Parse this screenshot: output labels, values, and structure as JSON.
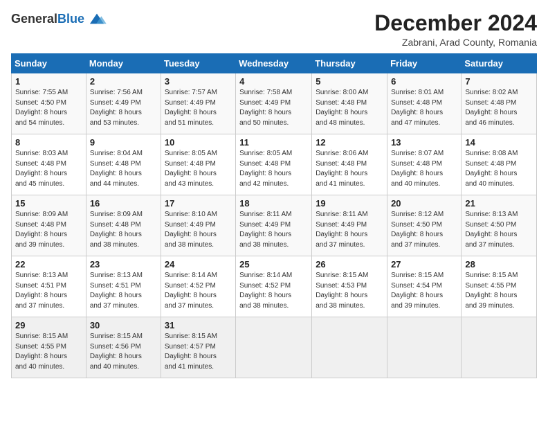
{
  "header": {
    "logo_general": "General",
    "logo_blue": "Blue",
    "month_title": "December 2024",
    "location": "Zabrani, Arad County, Romania"
  },
  "weekdays": [
    "Sunday",
    "Monday",
    "Tuesday",
    "Wednesday",
    "Thursday",
    "Friday",
    "Saturday"
  ],
  "weeks": [
    [
      {
        "day": "1",
        "info": "Sunrise: 7:55 AM\nSunset: 4:50 PM\nDaylight: 8 hours\nand 54 minutes."
      },
      {
        "day": "2",
        "info": "Sunrise: 7:56 AM\nSunset: 4:49 PM\nDaylight: 8 hours\nand 53 minutes."
      },
      {
        "day": "3",
        "info": "Sunrise: 7:57 AM\nSunset: 4:49 PM\nDaylight: 8 hours\nand 51 minutes."
      },
      {
        "day": "4",
        "info": "Sunrise: 7:58 AM\nSunset: 4:49 PM\nDaylight: 8 hours\nand 50 minutes."
      },
      {
        "day": "5",
        "info": "Sunrise: 8:00 AM\nSunset: 4:48 PM\nDaylight: 8 hours\nand 48 minutes."
      },
      {
        "day": "6",
        "info": "Sunrise: 8:01 AM\nSunset: 4:48 PM\nDaylight: 8 hours\nand 47 minutes."
      },
      {
        "day": "7",
        "info": "Sunrise: 8:02 AM\nSunset: 4:48 PM\nDaylight: 8 hours\nand 46 minutes."
      }
    ],
    [
      {
        "day": "8",
        "info": "Sunrise: 8:03 AM\nSunset: 4:48 PM\nDaylight: 8 hours\nand 45 minutes."
      },
      {
        "day": "9",
        "info": "Sunrise: 8:04 AM\nSunset: 4:48 PM\nDaylight: 8 hours\nand 44 minutes."
      },
      {
        "day": "10",
        "info": "Sunrise: 8:05 AM\nSunset: 4:48 PM\nDaylight: 8 hours\nand 43 minutes."
      },
      {
        "day": "11",
        "info": "Sunrise: 8:05 AM\nSunset: 4:48 PM\nDaylight: 8 hours\nand 42 minutes."
      },
      {
        "day": "12",
        "info": "Sunrise: 8:06 AM\nSunset: 4:48 PM\nDaylight: 8 hours\nand 41 minutes."
      },
      {
        "day": "13",
        "info": "Sunrise: 8:07 AM\nSunset: 4:48 PM\nDaylight: 8 hours\nand 40 minutes."
      },
      {
        "day": "14",
        "info": "Sunrise: 8:08 AM\nSunset: 4:48 PM\nDaylight: 8 hours\nand 40 minutes."
      }
    ],
    [
      {
        "day": "15",
        "info": "Sunrise: 8:09 AM\nSunset: 4:48 PM\nDaylight: 8 hours\nand 39 minutes."
      },
      {
        "day": "16",
        "info": "Sunrise: 8:09 AM\nSunset: 4:48 PM\nDaylight: 8 hours\nand 38 minutes."
      },
      {
        "day": "17",
        "info": "Sunrise: 8:10 AM\nSunset: 4:49 PM\nDaylight: 8 hours\nand 38 minutes."
      },
      {
        "day": "18",
        "info": "Sunrise: 8:11 AM\nSunset: 4:49 PM\nDaylight: 8 hours\nand 38 minutes."
      },
      {
        "day": "19",
        "info": "Sunrise: 8:11 AM\nSunset: 4:49 PM\nDaylight: 8 hours\nand 37 minutes."
      },
      {
        "day": "20",
        "info": "Sunrise: 8:12 AM\nSunset: 4:50 PM\nDaylight: 8 hours\nand 37 minutes."
      },
      {
        "day": "21",
        "info": "Sunrise: 8:13 AM\nSunset: 4:50 PM\nDaylight: 8 hours\nand 37 minutes."
      }
    ],
    [
      {
        "day": "22",
        "info": "Sunrise: 8:13 AM\nSunset: 4:51 PM\nDaylight: 8 hours\nand 37 minutes."
      },
      {
        "day": "23",
        "info": "Sunrise: 8:13 AM\nSunset: 4:51 PM\nDaylight: 8 hours\nand 37 minutes."
      },
      {
        "day": "24",
        "info": "Sunrise: 8:14 AM\nSunset: 4:52 PM\nDaylight: 8 hours\nand 37 minutes."
      },
      {
        "day": "25",
        "info": "Sunrise: 8:14 AM\nSunset: 4:52 PM\nDaylight: 8 hours\nand 38 minutes."
      },
      {
        "day": "26",
        "info": "Sunrise: 8:15 AM\nSunset: 4:53 PM\nDaylight: 8 hours\nand 38 minutes."
      },
      {
        "day": "27",
        "info": "Sunrise: 8:15 AM\nSunset: 4:54 PM\nDaylight: 8 hours\nand 39 minutes."
      },
      {
        "day": "28",
        "info": "Sunrise: 8:15 AM\nSunset: 4:55 PM\nDaylight: 8 hours\nand 39 minutes."
      }
    ],
    [
      {
        "day": "29",
        "info": "Sunrise: 8:15 AM\nSunset: 4:55 PM\nDaylight: 8 hours\nand 40 minutes."
      },
      {
        "day": "30",
        "info": "Sunrise: 8:15 AM\nSunset: 4:56 PM\nDaylight: 8 hours\nand 40 minutes."
      },
      {
        "day": "31",
        "info": "Sunrise: 8:15 AM\nSunset: 4:57 PM\nDaylight: 8 hours\nand 41 minutes."
      },
      {
        "day": "",
        "info": ""
      },
      {
        "day": "",
        "info": ""
      },
      {
        "day": "",
        "info": ""
      },
      {
        "day": "",
        "info": ""
      }
    ]
  ]
}
